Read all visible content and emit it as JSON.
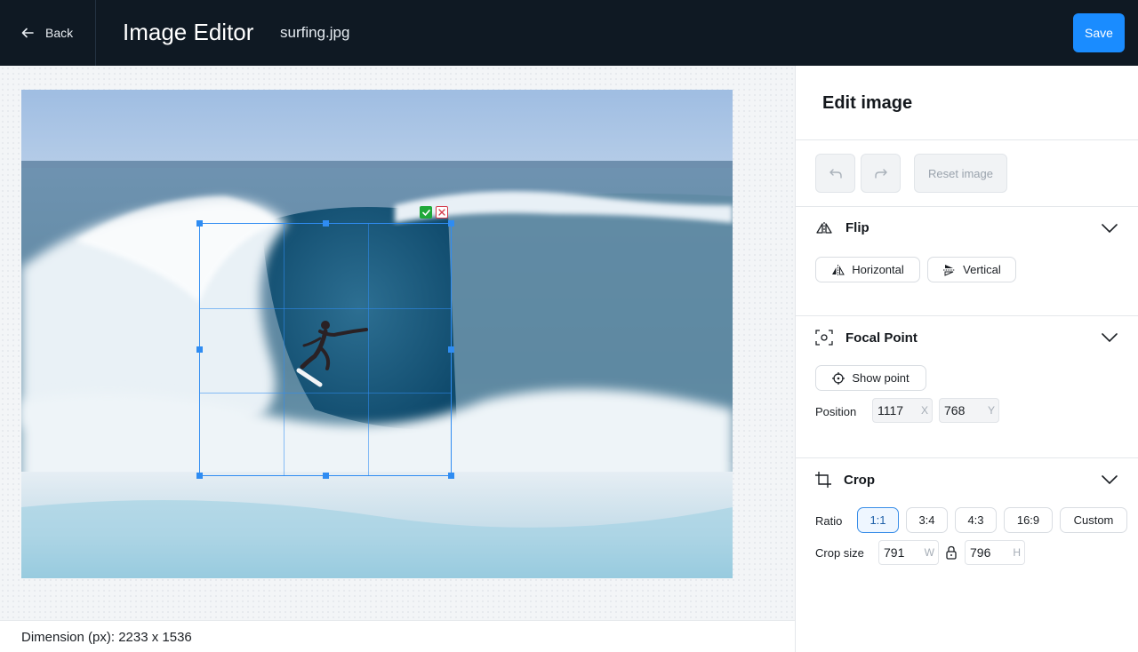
{
  "header": {
    "back_label": "Back",
    "app_title": "Image Editor",
    "file_name": "surfing.jpg",
    "save_label": "Save"
  },
  "canvas": {
    "image_subject": "surfer riding a barreling wave",
    "dimension_text": "Dimension (px): 2233 x 1536"
  },
  "panel": {
    "title": "Edit image",
    "reset_label": "Reset image",
    "flip": {
      "title": "Flip",
      "horizontal_label": "Horizontal",
      "vertical_label": "Vertical"
    },
    "focal_point": {
      "title": "Focal Point",
      "show_point_label": "Show point",
      "position_label": "Position",
      "x_value": "1117",
      "x_suffix": "X",
      "y_value": "768",
      "y_suffix": "Y"
    },
    "crop": {
      "title": "Crop",
      "ratio_label": "Ratio",
      "ratios": [
        "1:1",
        "3:4",
        "4:3",
        "16:9",
        "Custom"
      ],
      "selected_ratio": "1:1",
      "size_label": "Crop size",
      "width_value": "791",
      "width_suffix": "W",
      "height_value": "796",
      "height_suffix": "H"
    }
  },
  "colors": {
    "topbar": "#0f1923",
    "accent": "#1a8cff",
    "crop_outline": "#2f8cf2",
    "confirm": "#1fa83a",
    "cancel": "#d33a4a"
  },
  "icons": [
    "arrow-left-icon",
    "undo-icon",
    "redo-icon",
    "flip-icon",
    "flip-horizontal-icon",
    "flip-vertical-icon",
    "focal-point-icon",
    "crosshair-icon",
    "crop-icon",
    "lock-icon",
    "chevron-down-icon",
    "check-icon",
    "close-icon"
  ]
}
